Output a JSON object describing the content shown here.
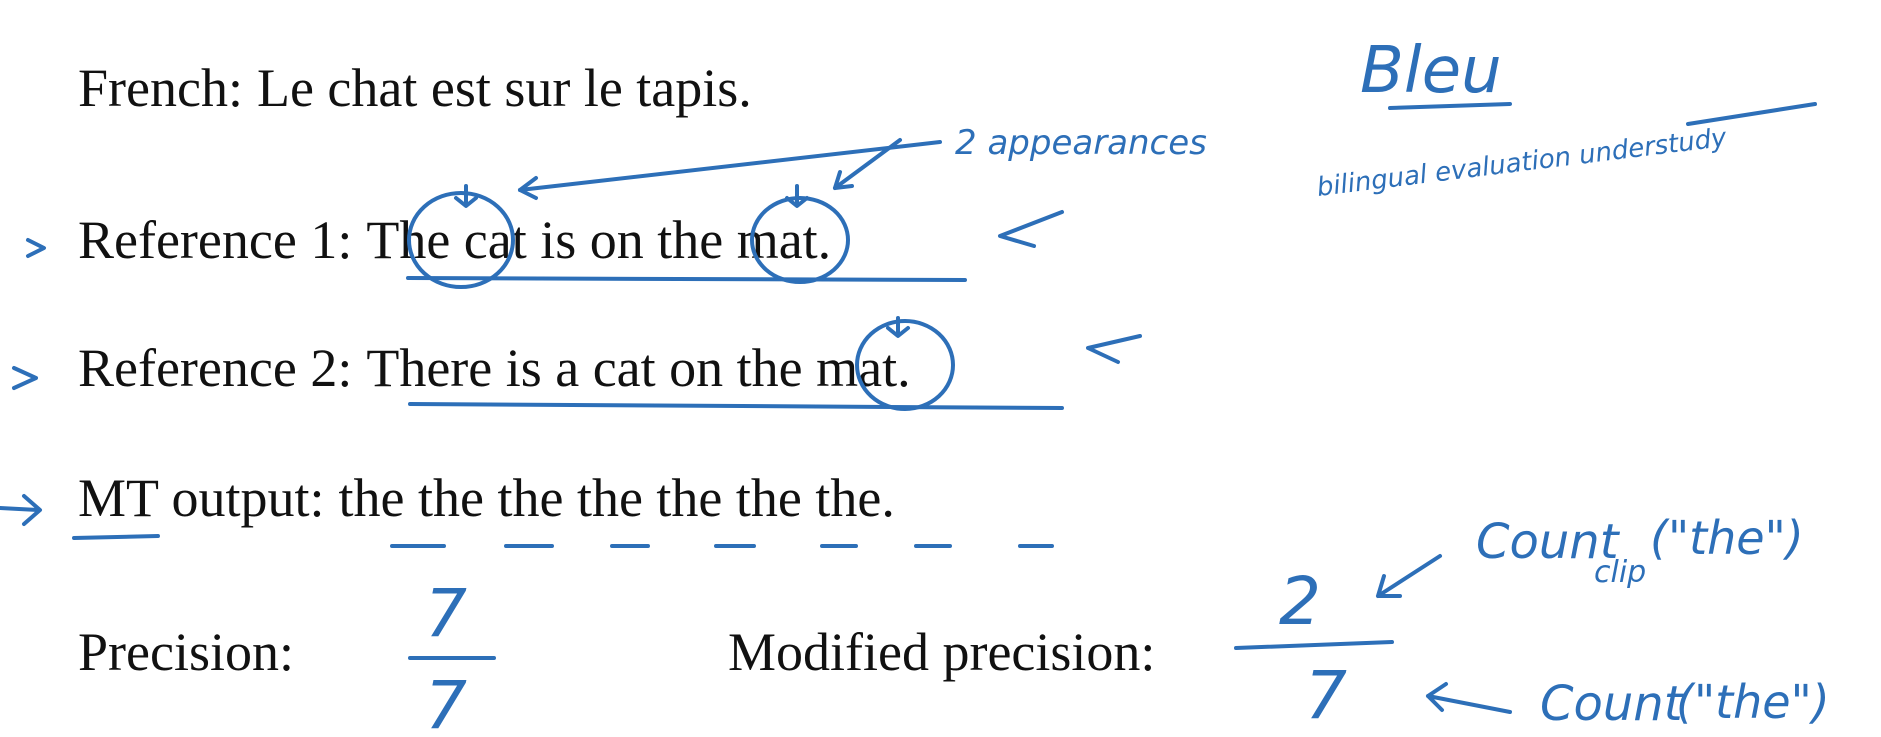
{
  "slide": {
    "french_line": {
      "label": "French:",
      "text": "Le chat est sur le tapis."
    },
    "reference_1": {
      "label": "Reference 1:",
      "text": "The cat is on the mat."
    },
    "reference_2": {
      "label": "Reference 2:",
      "text": "There is a cat on the mat."
    },
    "mt_output": {
      "label": "MT output:",
      "text": "the the the the the the the."
    },
    "precision": {
      "label": "Precision:"
    },
    "modified_precision": {
      "label": "Modified precision:"
    }
  },
  "annotations": {
    "ink_color": "#2d6fb8",
    "title": "Bleu",
    "expansion": "bilingual evaluation understudy",
    "appearances_note": "2 appearances",
    "precision_numerator": "7",
    "precision_denominator": "7",
    "modified_numerator": "2",
    "modified_denominator": "7",
    "count_clip_label": "Count",
    "count_clip_subscript": "clip",
    "count_clip_arg": "(\"the\")",
    "count_label": "Count",
    "count_arg": "(\"the\")"
  }
}
